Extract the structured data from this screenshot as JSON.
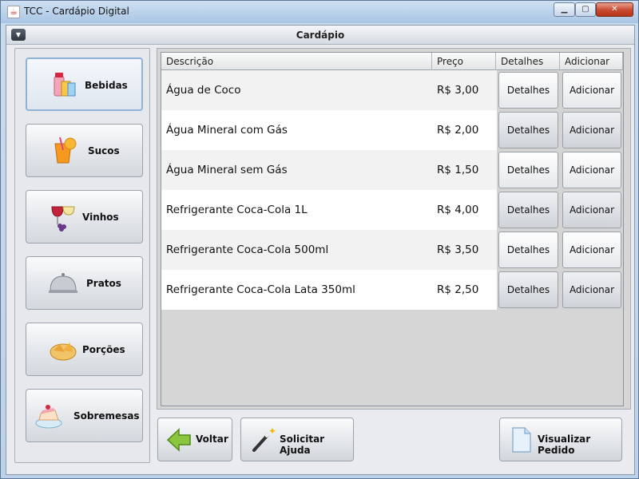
{
  "window": {
    "title": "TCC - Cardápio Digital",
    "app_icon": "java-cup-icon",
    "minimize_icon": "minimize-icon",
    "maximize_icon": "maximize-icon",
    "close_icon": "close-icon"
  },
  "panel": {
    "title": "Cardápio",
    "collapse_icon": "chevron-down-icon"
  },
  "sidebar": {
    "items": [
      {
        "label": "Bebidas",
        "icon": "drinks-icon",
        "active": true
      },
      {
        "label": "Sucos",
        "icon": "juice-icon",
        "active": false
      },
      {
        "label": "Vinhos",
        "icon": "wine-icon",
        "active": false
      },
      {
        "label": "Pratos",
        "icon": "cloche-icon",
        "active": false
      },
      {
        "label": "Porções",
        "icon": "snacks-icon",
        "active": false
      },
      {
        "label": "Sobremesas",
        "icon": "cake-icon",
        "active": false
      }
    ]
  },
  "table": {
    "columns": [
      "Descrição",
      "Preço",
      "Detalhes",
      "Adicionar"
    ],
    "rows": [
      {
        "descricao": "Água de Coco",
        "preco": "R$ 3,00",
        "detalhes": "Detalhes",
        "adicionar": "Adicionar"
      },
      {
        "descricao": "Água Mineral com Gás",
        "preco": "R$ 2,00",
        "detalhes": "Detalhes",
        "adicionar": "Adicionar"
      },
      {
        "descricao": "Água Mineral sem Gás",
        "preco": "R$ 1,50",
        "detalhes": "Detalhes",
        "adicionar": "Adicionar"
      },
      {
        "descricao": "Refrigerante Coca-Cola 1L",
        "preco": "R$ 4,00",
        "detalhes": "Detalhes",
        "adicionar": "Adicionar"
      },
      {
        "descricao": "Refrigerante Coca-Cola 500ml",
        "preco": "R$ 3,50",
        "detalhes": "Detalhes",
        "adicionar": "Adicionar"
      },
      {
        "descricao": "Refrigerante Coca-Cola Lata 350ml",
        "preco": "R$ 2,50",
        "detalhes": "Detalhes",
        "adicionar": "Adicionar"
      }
    ]
  },
  "footer": {
    "back": {
      "label": "Voltar",
      "icon": "arrow-left-icon"
    },
    "help": {
      "label": "Solicitar Ajuda",
      "icon": "magic-wand-icon"
    },
    "order": {
      "label": "Visualizar Pedido",
      "icon": "document-icon"
    }
  }
}
